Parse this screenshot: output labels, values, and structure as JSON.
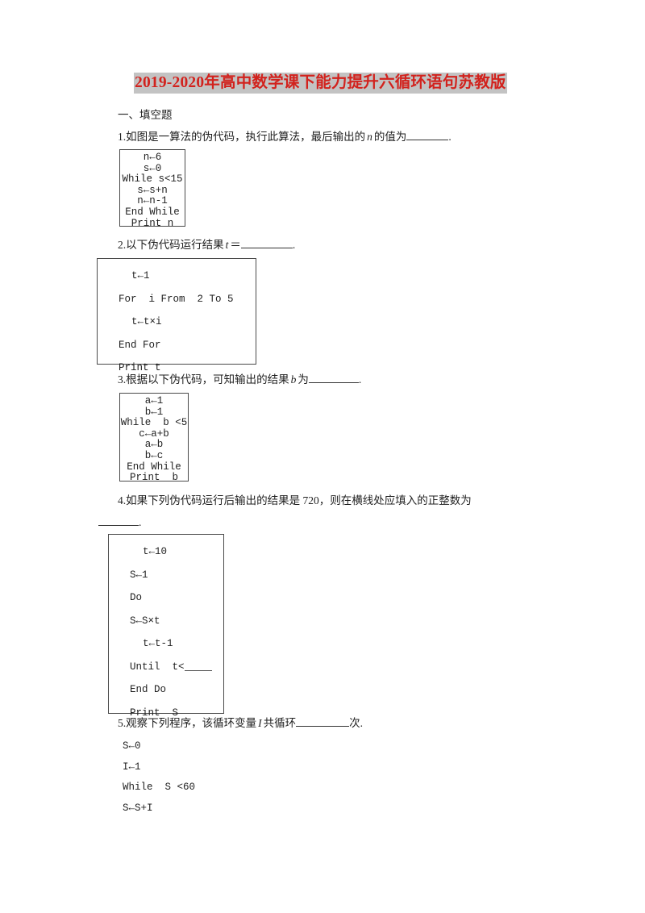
{
  "document": {
    "title": "2019-2020年高中数学课下能力提升六循环语句苏教版",
    "title_color": "#d2221d",
    "title_highlight": "#c3c3c3",
    "section_heading": "一、填空题"
  },
  "questions": [
    {
      "number": "1.",
      "text_before": "如图是一算法的伪代码，执行此算法，最后输出的",
      "var": "n",
      "text_after": "的值为",
      "tail": ".",
      "code": {
        "style": "boxed-tight",
        "lines": [
          "n←6",
          "s←0",
          "While s<15",
          "s←s+n",
          "n←n-1",
          "End While",
          "Print n"
        ]
      }
    },
    {
      "number": "2.",
      "text_before": "以下伪代码运行结果",
      "var": "t",
      "text_after": "＝",
      "tail": ".",
      "code": {
        "style": "boxed-roomy",
        "lines": [
          "t←1",
          "For  i From  2 To 5",
          "t←t×i",
          "End For",
          "Print t"
        ]
      }
    },
    {
      "number": "3.",
      "text_before": "根据以下伪代码，可知输出的结果",
      "var": "b",
      "text_after": "为",
      "tail": ".",
      "code": {
        "style": "boxed-tight",
        "lines": [
          "a←1",
          "b←1",
          "While  b <5",
          "c←a+b",
          "a←b",
          "b←c",
          "End While",
          "Print  b"
        ]
      }
    },
    {
      "number": "4.",
      "line1": "如果下列伪代码运行后输出的结果是 720，则在横线处应填入的正整数为",
      "line2_tail": ".",
      "code": {
        "style": "boxed-roomy",
        "lines": [
          "t←10",
          "S←1",
          "Do",
          "S←S×t",
          "t←t-1",
          "Until  t<____",
          "End Do",
          "Print  S"
        ]
      }
    },
    {
      "number": "5.",
      "text_before": "观察下列程序，该循环变量",
      "var": "I",
      "text_after": "共循环",
      "tail": "次.",
      "code": {
        "style": "plain",
        "lines": [
          "S←0",
          "I←1",
          "While  S <60",
          "S←S+I"
        ]
      }
    }
  ]
}
